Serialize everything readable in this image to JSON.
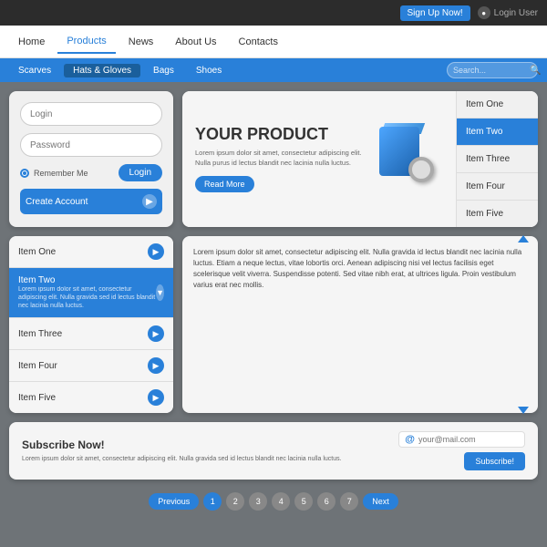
{
  "topbar": {
    "signup_label": "Sign Up Now!",
    "login_label": "Login User"
  },
  "navbar": {
    "items": [
      {
        "label": "Home"
      },
      {
        "label": "Products",
        "active": true
      },
      {
        "label": "News"
      },
      {
        "label": "About Us"
      },
      {
        "label": "Contacts"
      }
    ]
  },
  "subnav": {
    "items": [
      {
        "label": "Scarves"
      },
      {
        "label": "Hats & Gloves",
        "active": true
      },
      {
        "label": "Bags"
      },
      {
        "label": "Shoes"
      }
    ],
    "search_placeholder": "Search..."
  },
  "login_widget": {
    "login_placeholder": "Login",
    "password_placeholder": "Password",
    "remember_label": "Remember Me",
    "login_btn": "Login",
    "create_account": "Create Account"
  },
  "product": {
    "title": "YOUR PRODUCT",
    "description": "Lorem ipsum dolor sit amet, consectetur adipiscing elit. Nulla purus id lectus blandit nec lacinia nulla luctus.",
    "read_more": "Read More"
  },
  "right_items": [
    {
      "label": "Item One"
    },
    {
      "label": "Item Two",
      "active": true
    },
    {
      "label": "Item Three"
    },
    {
      "label": "Item Four"
    },
    {
      "label": "Item Five"
    }
  ],
  "left_items": [
    {
      "label": "Item One"
    },
    {
      "label": "Item Two",
      "active": true,
      "sub": "Lorem ipsum dolor sit amet, consectetur adipiscing elit. Nulla gravida sed id lectus blandit nec lacinia nulla luctus."
    },
    {
      "label": "Item Three"
    },
    {
      "label": "Item Four"
    },
    {
      "label": "Item Five"
    }
  ],
  "text_content": "Lorem ipsum dolor sit amet, consectetur adipiscing elit. Nulla gravida id lectus blandit nec lacinia nulla luctus. Etiam a neque lectus, vitae lobortis orci. Aenean adipiscing nisi vel lectus facilisis eget scelerisque velit viverra. Suspendisse potenti. Sed vitae nibh erat, at ultrices ligula. Proin vestibulum varius erat nec mollis.",
  "subscribe": {
    "title": "Subscribe Now!",
    "description": "Lorem ipsum dolor sit amet, consectetur adipiscing elit. Nulla gravida sed id lectus blandit nec lacinia nulla luctus.",
    "email_placeholder": "your@mail.com",
    "btn_label": "Subscribe!"
  },
  "pagination": {
    "prev": "Previous",
    "next": "Next",
    "pages": [
      "1",
      "2",
      "3",
      "4",
      "5",
      "6",
      "7"
    ],
    "active_page": 1
  }
}
